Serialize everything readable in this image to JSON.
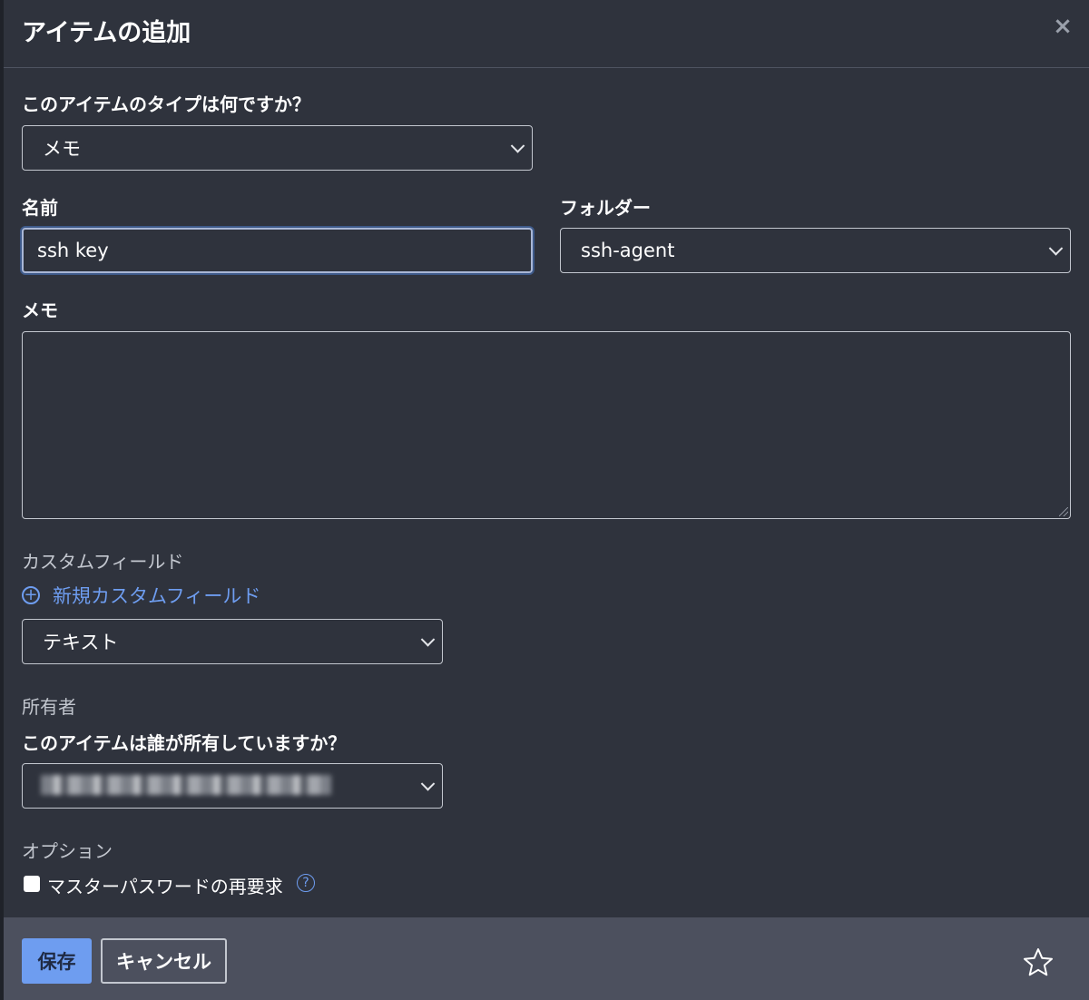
{
  "dialog": {
    "title": "アイテムの追加",
    "close_icon": "×"
  },
  "type_field": {
    "label": "このアイテムのタイプは何ですか？",
    "selected": "メモ"
  },
  "name_field": {
    "label": "名前",
    "value": "ssh key"
  },
  "folder_field": {
    "label": "フォルダー",
    "selected": "ssh-agent"
  },
  "notes_field": {
    "label": "メモ",
    "value": ""
  },
  "custom_fields": {
    "section_label": "カスタムフィールド",
    "add_link": "新規カスタムフィールド",
    "add_icon": "+",
    "type_selected": "テキスト"
  },
  "ownership": {
    "section_label": "所有者",
    "question": "このアイテムは誰が所有していますか？"
  },
  "options": {
    "section_label": "オプション",
    "reprompt_label": "マスターパスワードの再要求",
    "reprompt_checked": false,
    "help_icon": "?"
  },
  "footer": {
    "save_label": "保存",
    "cancel_label": "キャンセル"
  },
  "colors": {
    "background": "#2f333d",
    "footer": "#4c505e",
    "accent": "#6e9df0"
  }
}
